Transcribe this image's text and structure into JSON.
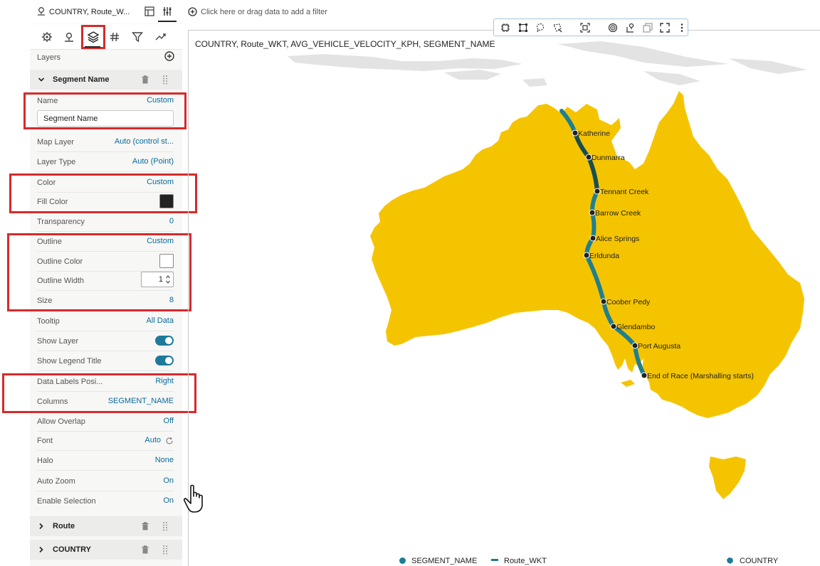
{
  "filter_bar": {
    "prompt": "Click here or drag data to add a filter"
  },
  "panel": {
    "title": "COUNTRY, Route_W...",
    "tabs": [
      "gear-icon",
      "pin-icon",
      "layers-icon",
      "hash-icon",
      "filter-icon",
      "trend-icon"
    ],
    "selected_tab": "layers-icon",
    "layers_label": "Layers",
    "sections": [
      {
        "title": "Segment Name",
        "expanded": true
      },
      {
        "title": "Route",
        "expanded": false
      },
      {
        "title": "COUNTRY",
        "expanded": false
      }
    ],
    "props": {
      "name": {
        "label": "Name",
        "value": "Custom",
        "input": "Segment Name"
      },
      "map_layer": {
        "label": "Map Layer",
        "value": "Auto (control st..."
      },
      "layer_type": {
        "label": "Layer Type",
        "value": "Auto (Point)"
      },
      "color": {
        "label": "Color",
        "value": "Custom"
      },
      "fill_color": {
        "label": "Fill Color",
        "color": "#222222"
      },
      "transparency": {
        "label": "Transparency",
        "value": "0"
      },
      "outline": {
        "label": "Outline",
        "value": "Custom"
      },
      "outline_color": {
        "label": "Outline Color",
        "color": "#ffffff"
      },
      "outline_width": {
        "label": "Outline Width",
        "value": "1"
      },
      "size": {
        "label": "Size",
        "value": "8"
      },
      "tooltip": {
        "label": "Tooltip",
        "value": "All Data"
      },
      "show_layer": {
        "label": "Show Layer",
        "on": true
      },
      "show_legend_title": {
        "label": "Show Legend Title",
        "on": true
      },
      "data_labels_position": {
        "label": "Data Labels Posi...",
        "value": "Right"
      },
      "columns": {
        "label": "Columns",
        "value": "SEGMENT_NAME"
      },
      "allow_overlap": {
        "label": "Allow Overlap",
        "value": "Off"
      },
      "font": {
        "label": "Font",
        "value": "Auto"
      },
      "halo": {
        "label": "Halo",
        "value": "None"
      },
      "auto_zoom": {
        "label": "Auto Zoom",
        "value": "On"
      },
      "enable_selection": {
        "label": "Enable Selection",
        "value": "On"
      }
    }
  },
  "viz": {
    "title": "COUNTRY, Route_WKT, AVG_VEHICLE_VELOCITY_KPH, SEGMENT_NAME",
    "toolbar_icons": [
      "chip-icon",
      "select-rect-icon",
      "lasso-icon",
      "polygon-select-icon",
      "zoom-to-fit-icon",
      "target-icon",
      "pin-cluster-icon",
      "copy-icon",
      "fullscreen-icon",
      "more-icon"
    ],
    "map": {
      "land_color": "#f5c400",
      "route_color": "#1f7f8f",
      "route_dark_color": "#1a4d4f",
      "segments": [
        "Katherine",
        "Dunmarra",
        "Tennant Creek",
        "Barrow Creek",
        "Alice Springs",
        "Erldunda",
        "Coober Pedy",
        "Glendambo",
        "Port Augusta",
        "End of Race (Marshalling starts)"
      ]
    },
    "legend": [
      {
        "label": "SEGMENT_NAME",
        "kind": "point"
      },
      {
        "label": "Route_WKT",
        "kind": "line"
      },
      {
        "label": "COUNTRY",
        "kind": "area"
      }
    ]
  }
}
